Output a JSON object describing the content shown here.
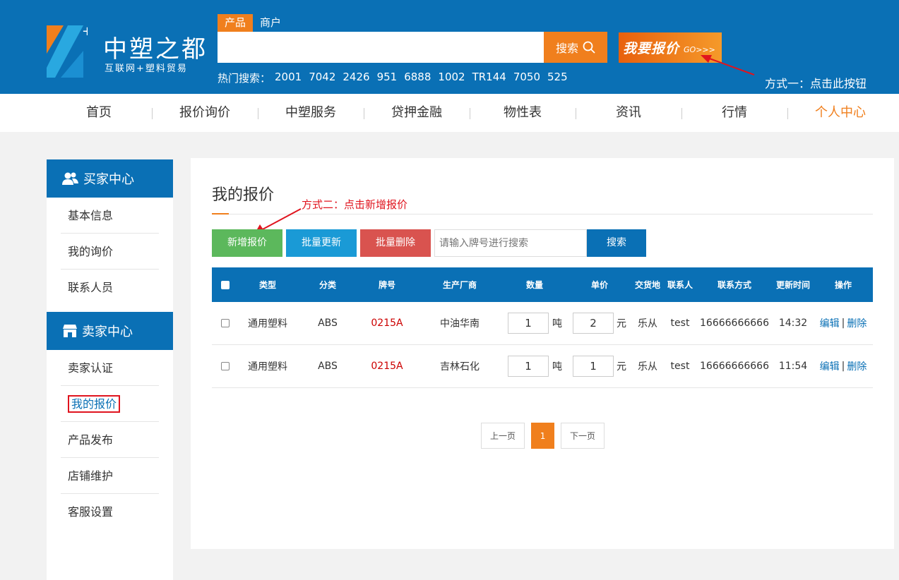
{
  "header": {
    "logo_title": "中塑之都",
    "logo_sub": "互联网+塑料贸易",
    "search_tabs": [
      "产品",
      "商户"
    ],
    "search_value": "",
    "search_button": "搜索",
    "quote_button": "我要报价",
    "quote_go": "GO>>>",
    "hot_label": "热门搜索：",
    "hot_words": [
      "2001",
      "7042",
      "2426",
      "951",
      "6888",
      "1002",
      "TR144",
      "7050",
      "525"
    ],
    "annotation": "方式一：点击此按钮"
  },
  "nav": [
    "首页",
    "报价询价",
    "中塑服务",
    "贷押金融",
    "物性表",
    "资讯",
    "行情",
    "个人中心"
  ],
  "sidebar": {
    "buyer_title": "买家中心",
    "buyer_items": [
      "基本信息",
      "我的询价",
      "联系人员"
    ],
    "seller_title": "卖家中心",
    "seller_items": [
      "卖家认证",
      "我的报价",
      "产品发布",
      "店铺维护",
      "客服设置"
    ]
  },
  "main": {
    "title": "我的报价",
    "annotation": "方式二：点击新增报价",
    "btn_add": "新增报价",
    "btn_batch_update": "批量更新",
    "btn_batch_delete": "批量删除",
    "search_placeholder": "请输入牌号进行搜索",
    "search_button": "搜索",
    "columns": [
      "类型",
      "分类",
      "牌号",
      "生产厂商",
      "数量",
      "单价",
      "交货地",
      "联系人",
      "联系方式",
      "更新时间",
      "操作"
    ],
    "rows": [
      {
        "type": "通用塑料",
        "category": "ABS",
        "grade": "0215A",
        "maker": "中油华南",
        "qty": "1",
        "qty_unit": "吨",
        "price": "2",
        "price_unit": "元",
        "place": "乐从",
        "contact": "test",
        "phone": "16666666666",
        "time": "14:32",
        "edit": "编辑",
        "sep": "|",
        "delete": "删除"
      },
      {
        "type": "通用塑料",
        "category": "ABS",
        "grade": "0215A",
        "maker": "吉林石化",
        "qty": "1",
        "qty_unit": "吨",
        "price": "1",
        "price_unit": "元",
        "place": "乐从",
        "contact": "test",
        "phone": "16666666666",
        "time": "11:54",
        "edit": "编辑",
        "sep": "|",
        "delete": "删除"
      }
    ],
    "pager": {
      "prev": "上一页",
      "current": "1",
      "next": "下一页"
    }
  },
  "colors": {
    "brand_blue": "#0a70b5",
    "accent_orange": "#f07f1d",
    "annotation_red": "#e0141e"
  }
}
